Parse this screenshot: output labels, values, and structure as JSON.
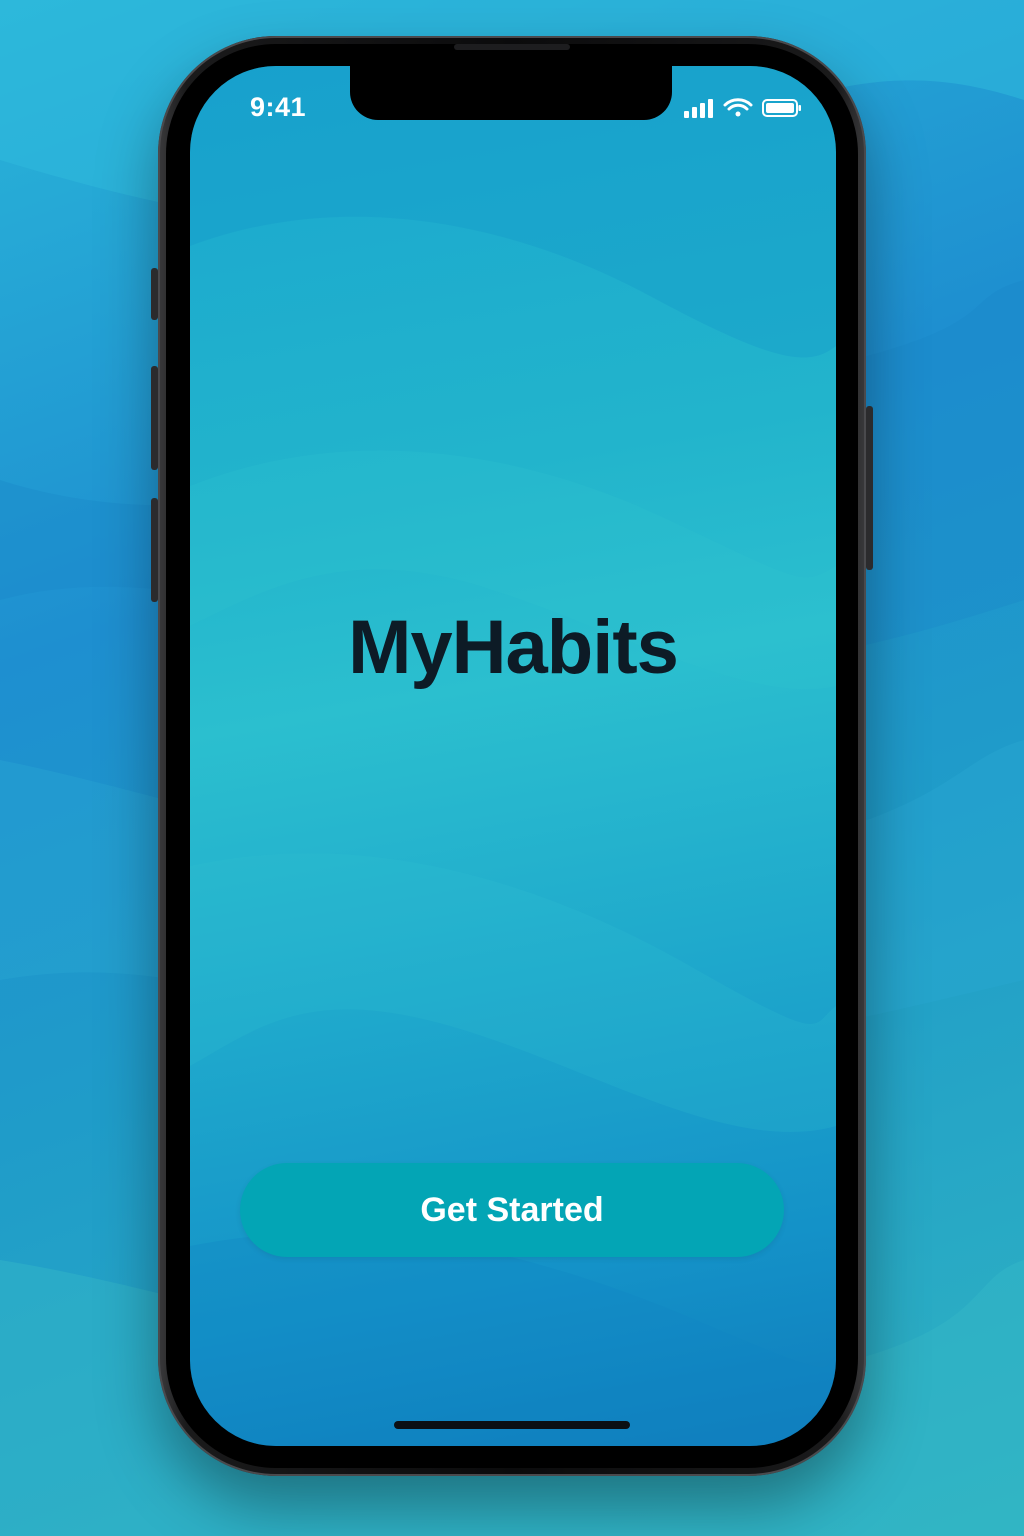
{
  "status_bar": {
    "time": "9:41",
    "icons": [
      "cellular-signal-icon",
      "wifi-icon",
      "battery-icon"
    ]
  },
  "app": {
    "title": "MyHabits"
  },
  "actions": {
    "get_started_label": "Get Started"
  },
  "colors": {
    "background_accent": "#1e8fd0",
    "screen_gradient_start": "#1aa6cf",
    "screen_gradient_end": "#0f7cbc",
    "button": "#03a5b5",
    "title_text": "#0d1b26",
    "button_text": "#ffffff"
  }
}
